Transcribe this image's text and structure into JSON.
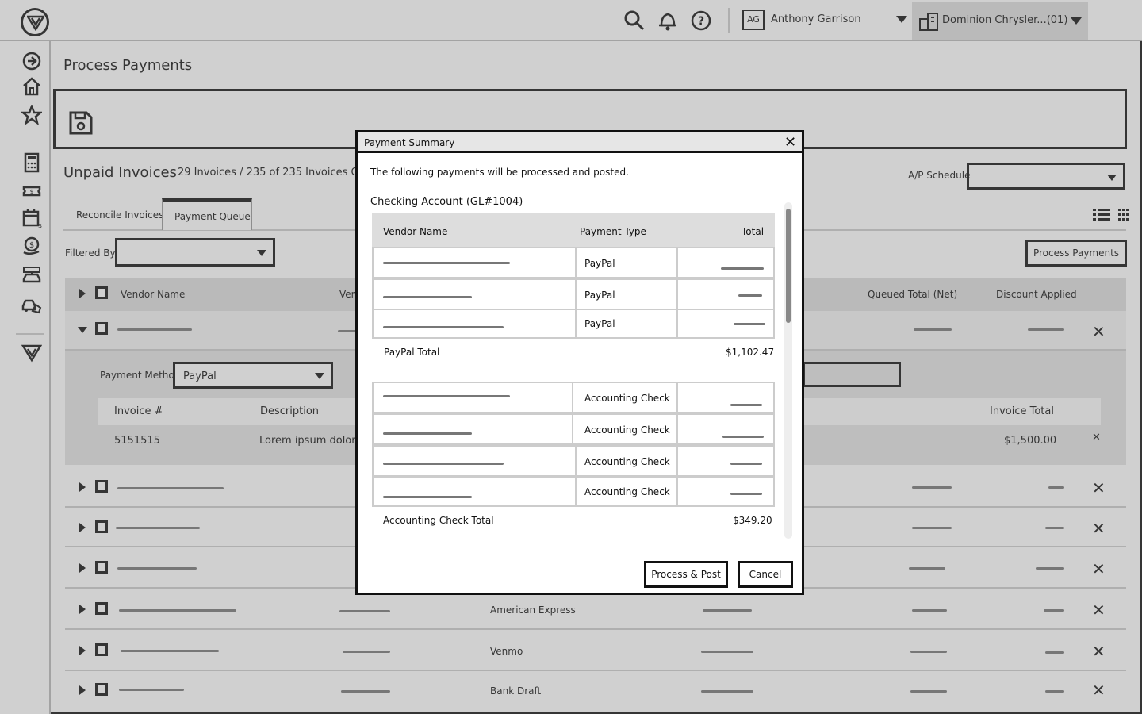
{
  "header": {
    "user_initials": "AG",
    "user_name": "Anthony Garrison",
    "organization": "Dominion Chrysler...(01)"
  },
  "page": {
    "title": "Process Payments"
  },
  "unpaid": {
    "title": "Unpaid Invoices",
    "count": "29 Invoices / 235 of 235 Invoices Queu",
    "ap_schedule_label": "A/P Schedule",
    "tabs": [
      "Reconcile Invoices",
      "Payment Queue"
    ],
    "filter_label": "Filtered By",
    "process_button": "Process Payments"
  },
  "grid": {
    "headers": {
      "vendor": "Vendor Name",
      "ven_partial": "Ven",
      "queued": "Queued Total (Net)",
      "discount": "Discount Applied"
    },
    "expanded": {
      "payment_method_label": "Payment Method",
      "payment_method_value": "PayPal",
      "sub_headers": {
        "invoice": "Invoice #",
        "description": "Description",
        "total": "Invoice Total"
      },
      "invoice_number": "5151515",
      "description": "Lorem ipsum dolor s",
      "invoice_total": "$1,500.00"
    },
    "payment_types": [
      "American Express",
      "Venmo",
      "Bank Draft"
    ]
  },
  "modal": {
    "title": "Payment Summary",
    "intro": "The following payments will be processed and posted.",
    "account": "Checking Account (GL#1004)",
    "headers": {
      "vendor": "Vendor Name",
      "type": "Payment Type",
      "total": "Total"
    },
    "paypal_rows": [
      "PayPal",
      "PayPal",
      "PayPal"
    ],
    "paypal_total_label": "PayPal Total",
    "paypal_total_value": "$1,102.47",
    "check_rows": [
      "Accounting Check",
      "Accounting Check",
      "Accounting Check",
      "Accounting Check"
    ],
    "check_total_label": "Accounting Check Total",
    "check_total_value": "$349.20",
    "process_button": "Process & Post",
    "cancel_button": "Cancel"
  }
}
